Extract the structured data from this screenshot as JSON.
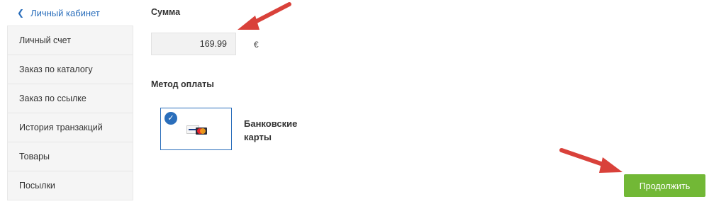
{
  "sidebar": {
    "back_label": "Личный кабинет",
    "items": [
      {
        "label": "Личный счет"
      },
      {
        "label": "Заказ по каталогу"
      },
      {
        "label": "Заказ по ссылке"
      },
      {
        "label": "История транзакций"
      },
      {
        "label": "Товары"
      },
      {
        "label": "Посылки"
      }
    ]
  },
  "main": {
    "sum_label": "Сумма",
    "amount_value": "169.99",
    "currency": "€",
    "payment_method_label": "Метод оплаты",
    "payment_option": {
      "name": "Банковские карты",
      "selected": true
    },
    "continue_label": "Продолжить"
  },
  "colors": {
    "accent_blue": "#2a6ebb",
    "button_green": "#72b836",
    "annotation_arrow": "#d9413a"
  },
  "icons": [
    "chevron-left-icon",
    "checkmark-icon",
    "bank-cards-icon"
  ]
}
